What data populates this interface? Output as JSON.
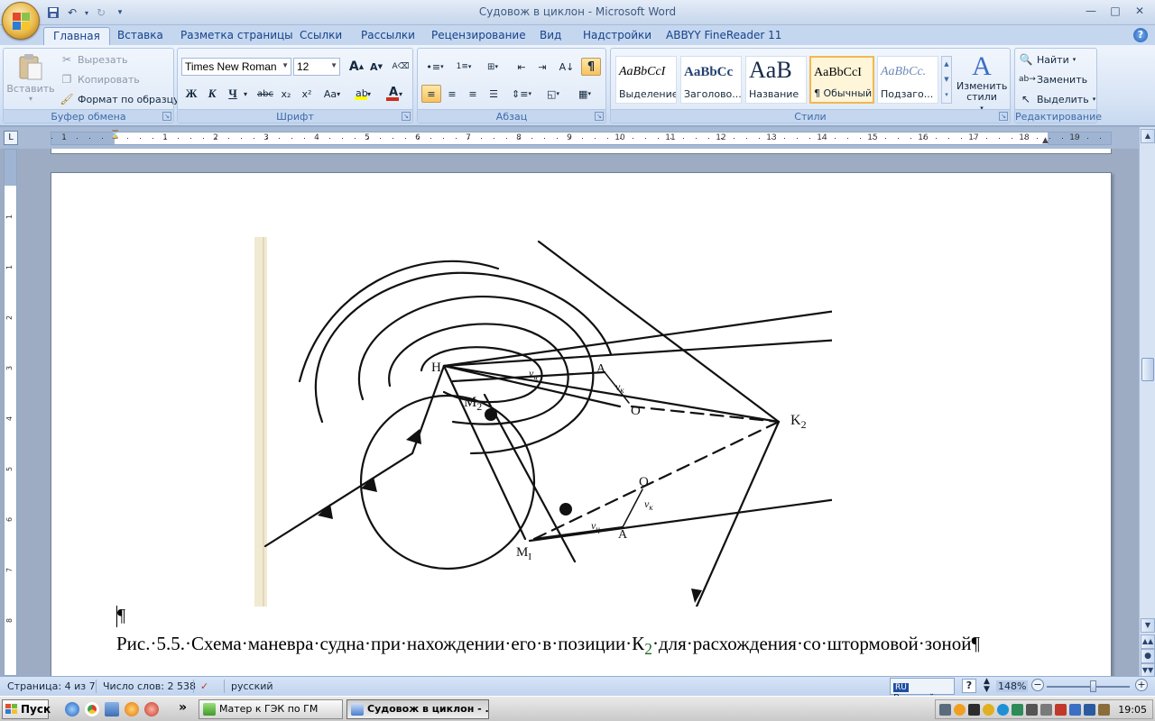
{
  "window": {
    "title": "Судовож в циклон - Microsoft Word"
  },
  "qat": {
    "save_icon": "save-icon",
    "undo_icon": "undo-icon",
    "redo_icon": "redo-icon"
  },
  "tabs": [
    {
      "label": "Главная",
      "active": true
    },
    {
      "label": "Вставка"
    },
    {
      "label": "Разметка страницы"
    },
    {
      "label": "Ссылки"
    },
    {
      "label": "Рассылки"
    },
    {
      "label": "Рецензирование"
    },
    {
      "label": "Вид"
    },
    {
      "label": "Надстройки"
    },
    {
      "label": "ABBYY FineReader 11"
    }
  ],
  "clipboard": {
    "label": "Буфер обмена",
    "paste": "Вставить",
    "cut": "Вырезать",
    "copy": "Копировать",
    "format_painter": "Формат по образцу"
  },
  "font": {
    "label": "Шрифт",
    "name": "Times New Roman",
    "size": "12",
    "bold": "Ж",
    "italic": "К",
    "underline": "Ч",
    "strike": "abc",
    "subscript": "x₂",
    "superscript": "x²",
    "case": "Aa",
    "grow": "A",
    "shrink": "A",
    "font_color": "A",
    "accent_red": "#d22a1d",
    "highlight_yellow": "#ffff00"
  },
  "paragraph": {
    "label": "Абзац"
  },
  "styles": {
    "label": "Стили",
    "items": [
      {
        "sample": "AaBbCcI",
        "name": "Выделение"
      },
      {
        "sample": "AaBbCc",
        "name": "Заголово..."
      },
      {
        "sample": "AaB",
        "name": "Название"
      },
      {
        "sample": "AaBbCcI",
        "name": "¶ Обычный",
        "selected": true
      },
      {
        "sample": "AaBbCc.",
        "name": "Подзаго..."
      }
    ],
    "change_styles": "Изменить стили"
  },
  "editing": {
    "label": "Редактирование",
    "find": "Найти",
    "replace": "Заменить",
    "select": "Выделить"
  },
  "ruler": {
    "numbers": [
      "1",
      "1",
      "2",
      "3",
      "4",
      "5",
      "6",
      "7",
      "8",
      "9",
      "10",
      "11",
      "12",
      "13",
      "14",
      "15",
      "16",
      "17",
      "18",
      "19"
    ],
    "vnumbers": [
      "1",
      "1",
      "2",
      "3",
      "4",
      "5",
      "6",
      "7",
      "8"
    ]
  },
  "document": {
    "para_mark": "¶",
    "caption_parts": {
      "before": "Рис.·5.5.·Схема·маневра·судна·при·нахождении·его·в·позиции·К",
      "sub": "2",
      "after": "·для·расхождения·со·штормовой·зоной¶"
    },
    "figure_labels": {
      "H": "H",
      "M2": "M",
      "M2_sub": "2",
      "M1": "M",
      "M1_sub": "I",
      "K2": "K",
      "K2_sub": "2",
      "O_upper": "O",
      "O_lower": "O",
      "A_upper": "A",
      "A_lower": "A",
      "Vc": "v",
      "Vc_sub": "ц",
      "Vk": "v",
      "Vk_sub": "к"
    }
  },
  "status": {
    "page": "Страница: 4 из 7",
    "words": "Число слов: 2 538",
    "language": "русский",
    "ime_lang": "Русский",
    "ime_flag": "RU",
    "zoom": "148%"
  },
  "taskbar": {
    "start": "Пуск",
    "tasks": [
      {
        "label": "Матер к ГЭК по ГМ"
      },
      {
        "label": "Судовож в циклон - ...",
        "active": true
      }
    ],
    "chevron": "»",
    "clock": "19:05"
  }
}
